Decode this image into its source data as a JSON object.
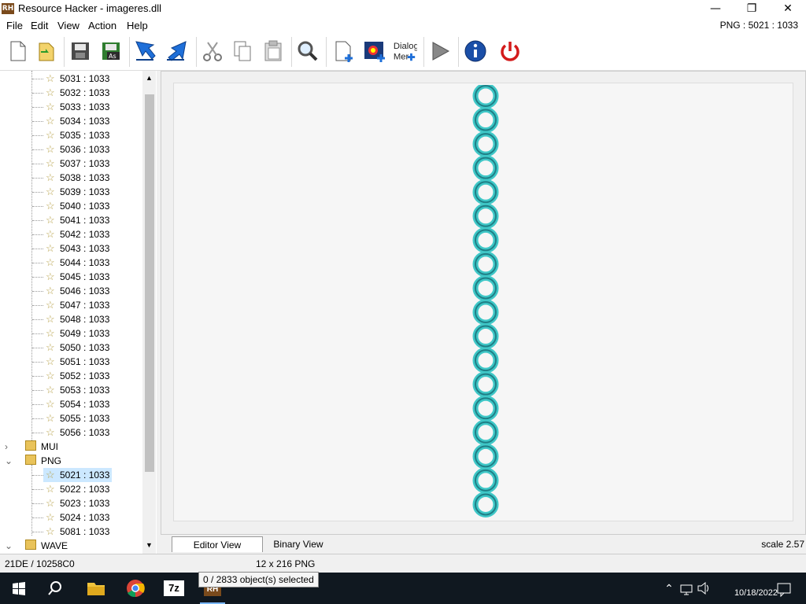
{
  "window": {
    "title": "Resource Hacker - imageres.dll",
    "app_icon_text": "RH",
    "minimize": "—",
    "maximize": "❐",
    "close": "✕"
  },
  "menu": {
    "items": [
      "File",
      "Edit",
      "View",
      "Action",
      "Help"
    ],
    "current_resource": "PNG : 5021 : 1033"
  },
  "toolbar": {
    "dialog_label_1": "Dialog",
    "dialog_label_2": "Mer"
  },
  "tree": {
    "items": [
      "5031 : 1033",
      "5032 : 1033",
      "5033 : 1033",
      "5034 : 1033",
      "5035 : 1033",
      "5036 : 1033",
      "5037 : 1033",
      "5038 : 1033",
      "5039 : 1033",
      "5040 : 1033",
      "5041 : 1033",
      "5042 : 1033",
      "5043 : 1033",
      "5044 : 1033",
      "5045 : 1033",
      "5046 : 1033",
      "5047 : 1033",
      "5048 : 1033",
      "5049 : 1033",
      "5050 : 1033",
      "5051 : 1033",
      "5052 : 1033",
      "5053 : 1033",
      "5054 : 1033",
      "5055 : 1033",
      "5056 : 1033"
    ],
    "folder_mui": "MUI",
    "folder_png": "PNG",
    "png_items": [
      "5021 : 1033",
      "5022 : 1033",
      "5023 : 1033",
      "5024 : 1033",
      "5081 : 1033"
    ],
    "folder_wave": "WAVE"
  },
  "editor": {
    "image_count": 18
  },
  "tabs": {
    "editor_view": "Editor View",
    "binary_view": "Binary View",
    "scale": "scale 2.57"
  },
  "status": {
    "offset": "21DE / 10258C0",
    "dimensions": "12 x 216  PNG",
    "selection": "0 / 2833 object(s) selected"
  },
  "taskbar": {
    "seven_zip": "7z",
    "date": "10/18/2022"
  },
  "colors": {
    "accent": "#0a6ed1",
    "selected_bg": "#cce8ff",
    "ring": "#3fc7c7"
  }
}
